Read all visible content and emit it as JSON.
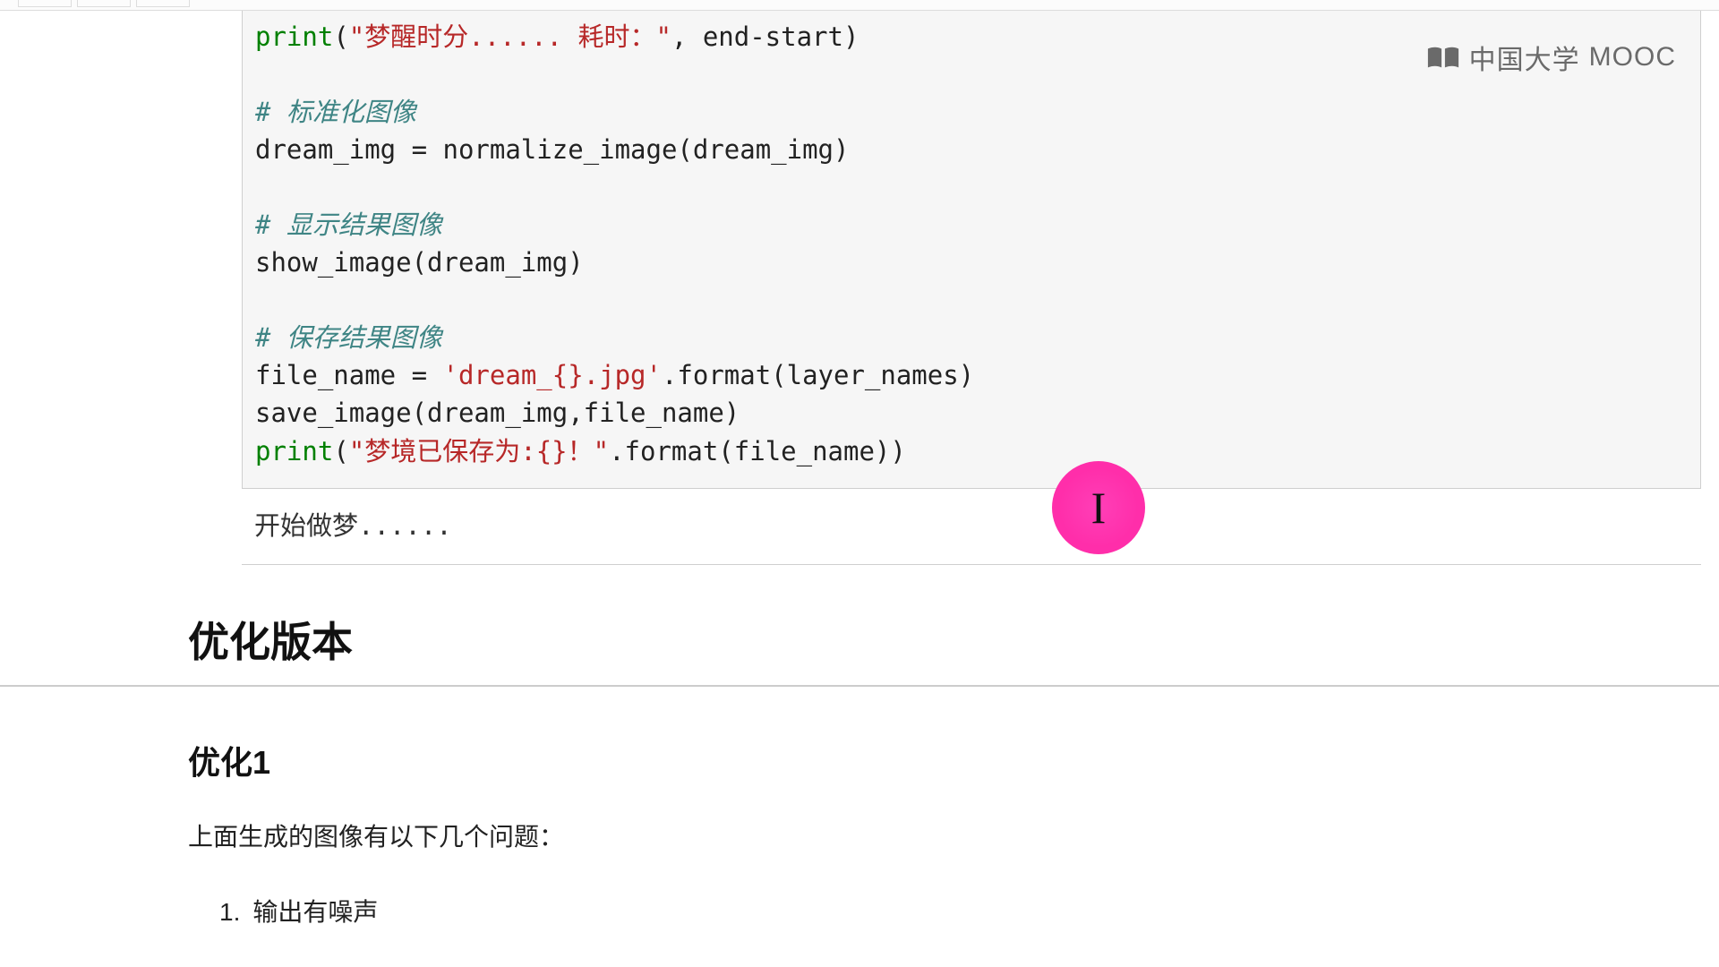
{
  "watermark": {
    "text_cn": "中国大学",
    "text_en": "MOOC"
  },
  "code": {
    "line1_print": "print",
    "line1_str": "\"梦醒时分...... 耗时：\"",
    "line1_rest": ", end-start)",
    "blank": "",
    "comment1": "# 标准化图像",
    "line2": "dream_img = normalize_image(dream_img)",
    "comment2": "# 显示结果图像",
    "line3": "show_image(dream_img)",
    "comment3": "# 保存结果图像",
    "line4_a": "file_name = ",
    "line4_str": "'dream_{}.jpg'",
    "line4_b": ".format(layer_names)",
    "line5": "save_image(dream_img,file_name)",
    "line6_print": "print",
    "line6_str": "\"梦境已保存为:{}！\"",
    "line6_b": ".format(file_name))"
  },
  "output": {
    "text": "开始做梦......"
  },
  "markdown": {
    "h1": "优化版本",
    "h2": "优化1",
    "para": "上面生成的图像有以下几个问题：",
    "list_1_num": "1.",
    "list_1_text": "输出有噪声"
  },
  "cursor": {
    "glyph": "I"
  }
}
